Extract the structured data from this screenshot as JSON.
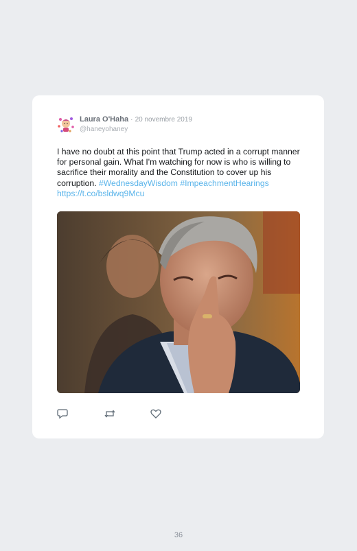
{
  "tweet": {
    "author": "Laura O'Haha",
    "separator": "·",
    "date": "20 novembre 2019",
    "handle": "@haneyohaney",
    "text_body": "I have no doubt at this point that Trump acted in a corrupt manner for personal gain. What I'm watching for now is who is willing to sacrifice their morality and the Constitution to cover up his corruption.",
    "hashtag_1": "#WednesdayWisdom",
    "hashtag_2": "#ImpeachmentHearings",
    "link": "https://t.co/bsldwq9Mcu",
    "media_description": "GIF of a gray-haired man in a dark jacket touching his face with one raised finger"
  },
  "actions": {
    "reply_icon": "reply-icon",
    "retweet_icon": "retweet-icon",
    "like_icon": "heart-icon"
  },
  "page": {
    "number": "36"
  },
  "colors": {
    "link": "#5ab4ea",
    "background": "#ebedf0",
    "card": "#ffffff"
  }
}
